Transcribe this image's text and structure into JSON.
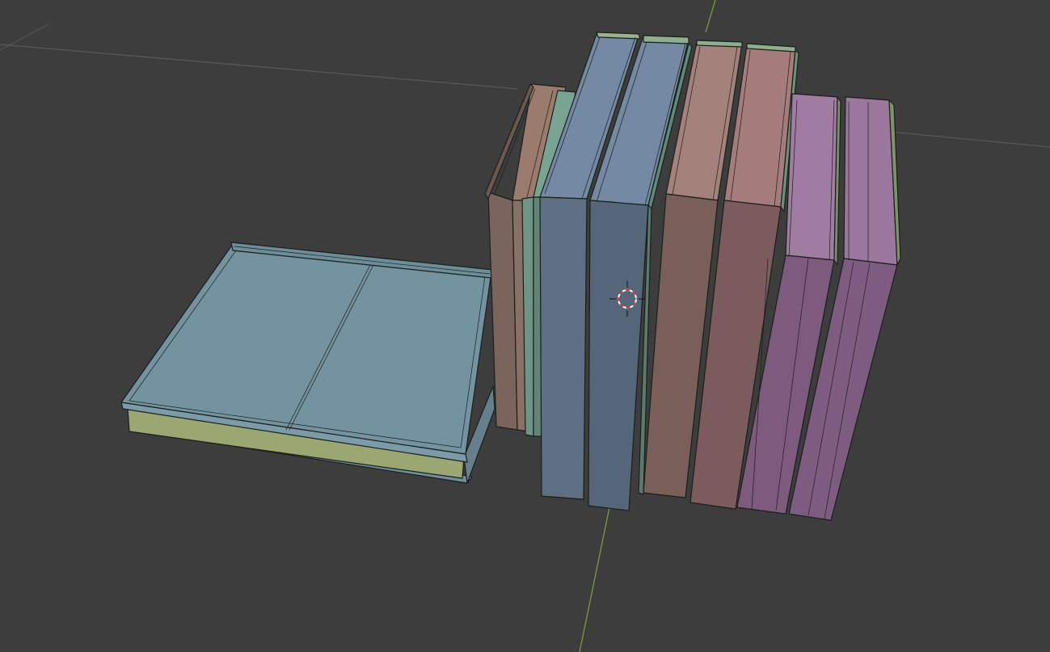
{
  "app": {
    "name": "3D viewport",
    "shading_mode": "solid-with-wireframe"
  },
  "viewport": {
    "background_color": "#3d3d3d",
    "grid_color": "#555555",
    "y_axis_color": "#7fa33b"
  },
  "scene": {
    "objects": [
      {
        "name": "book-lying-flat",
        "cover_color": "#7393a0",
        "page_color": "#8a9968"
      },
      {
        "name": "book-standing-1",
        "cover_color": "#8a7166"
      },
      {
        "name": "book-standing-2",
        "cover_color": "#6f9485"
      },
      {
        "name": "book-standing-3",
        "cover_color": "#6a7f96"
      },
      {
        "name": "book-standing-4",
        "cover_color": "#6a7f96"
      },
      {
        "name": "book-standing-5",
        "cover_color": "#8f6966"
      },
      {
        "name": "book-standing-6",
        "cover_color": "#8f6966"
      },
      {
        "name": "book-standing-7",
        "cover_color": "#8e6b8e"
      },
      {
        "name": "book-standing-8",
        "cover_color": "#8e6b8e"
      }
    ]
  },
  "icons": {
    "cursor": "3d-cursor-icon"
  }
}
